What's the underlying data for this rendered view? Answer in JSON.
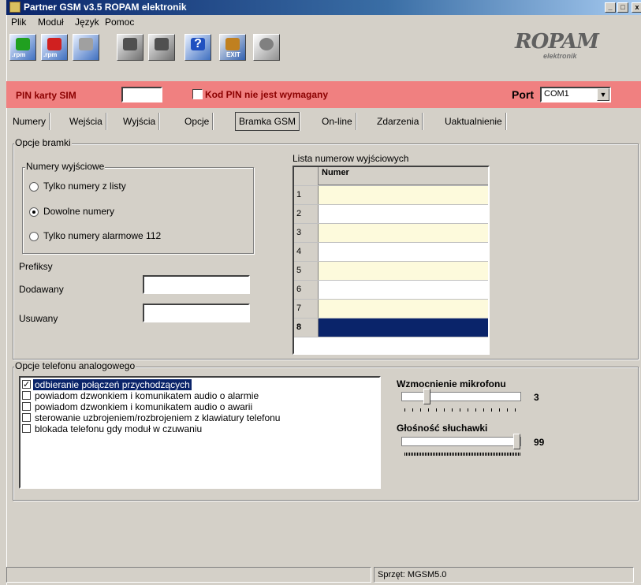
{
  "window": {
    "title": "Partner GSM v3.5 ROPAM elektronik",
    "min": "_",
    "max": "□",
    "close": "x"
  },
  "menu": [
    "Plik",
    "Moduł",
    "Język",
    "Pomoc"
  ],
  "toolbar": {
    "rpm1": ".rpm",
    "rpm2": ".rpm",
    "exit": "EXIT",
    "help": "?"
  },
  "logo": {
    "main": "ROPAM",
    "sub": "elektronik"
  },
  "pin": {
    "label": "PIN karty SIM",
    "value": "",
    "no_pin_label": "Kod PIN nie jest wymagany",
    "no_pin_checked": false
  },
  "port": {
    "label": "Port",
    "value": "COM1"
  },
  "tabs": [
    "Numery",
    "Wejścia",
    "Wyjścia",
    "Opcje",
    "Bramka GSM",
    "On-line",
    "Zdarzenia",
    "Uaktualnienie"
  ],
  "active_tab": "Bramka GSM",
  "gateway": {
    "group_label": "Opcje bramki",
    "outgoing_group": "Numery wyjściowe",
    "radios": [
      {
        "label": "Tylko numery z listy",
        "selected": false
      },
      {
        "label": "Dowolne numery",
        "selected": true
      },
      {
        "label": "Tylko numery alarmowe 112",
        "selected": false
      }
    ],
    "prefix_label": "Prefiksy",
    "added_label": "Dodawany",
    "added_value": "",
    "removed_label": "Usuwany",
    "removed_value": ""
  },
  "numbers": {
    "title": "Lista numerow wyjściowych",
    "column": "Numer",
    "rows": [
      {
        "id": "1",
        "value": ""
      },
      {
        "id": "2",
        "value": ""
      },
      {
        "id": "3",
        "value": ""
      },
      {
        "id": "4",
        "value": ""
      },
      {
        "id": "5",
        "value": ""
      },
      {
        "id": "6",
        "value": ""
      },
      {
        "id": "7",
        "value": ""
      },
      {
        "id": "8",
        "value": ""
      }
    ],
    "colors": {
      "odd": "#fdfadc",
      "even": "#ffffff",
      "selected": "#0a246a"
    }
  },
  "phone": {
    "group_label": "Opcje telefonu analogowego",
    "options": [
      {
        "label": "odbieranie połączeń przychodzących",
        "checked": true,
        "selected": true
      },
      {
        "label": "powiadom dzwonkiem i komunikatem audio o alarmie",
        "checked": false,
        "selected": false
      },
      {
        "label": "powiadom dzwonkiem i komunikatem audio o awarii",
        "checked": false,
        "selected": false
      },
      {
        "label": "sterowanie uzbrojeniem/rozbrojeniem z klawiatury telefonu",
        "checked": false,
        "selected": false
      },
      {
        "label": "blokada telefonu gdy moduł w czuwaniu",
        "checked": false,
        "selected": false
      }
    ],
    "mic_label": "Wzmocnienie mikrofonu",
    "mic_value": "3",
    "mic_fraction": 0.2,
    "spk_label": "Głośność słuchawki",
    "spk_value": "99",
    "spk_fraction": 1.0
  },
  "status": {
    "hardware": "Sprzęt: MGSM5.0"
  }
}
